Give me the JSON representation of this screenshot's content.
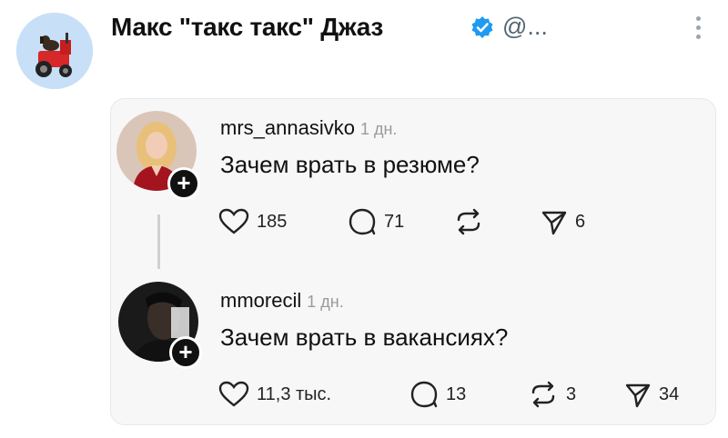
{
  "header": {
    "display_name": "Макс \"такс такс\" Джаз",
    "handle": "@...",
    "avatar_icon": "dog-on-tractor-avatar",
    "verified_icon": "verified-badge-icon",
    "more_icon": "more-vertical-icon"
  },
  "posts": [
    {
      "username": "mrs_annasivko",
      "time": "1 дн.",
      "text": "Зачем врать в резюме?",
      "likes": "185",
      "replies": "71",
      "reposts": "",
      "shares": "6"
    },
    {
      "username": "mmorecil",
      "time": "1 дн.",
      "text": "Зачем врать в вакансиях?",
      "likes": "11,3 тыс.",
      "replies": "13",
      "reposts": "3",
      "shares": "34"
    }
  ],
  "colors": {
    "verified": "#1d9bf0",
    "avatar_bg": "#c7dff7",
    "card_bg": "#f7f7f7"
  }
}
